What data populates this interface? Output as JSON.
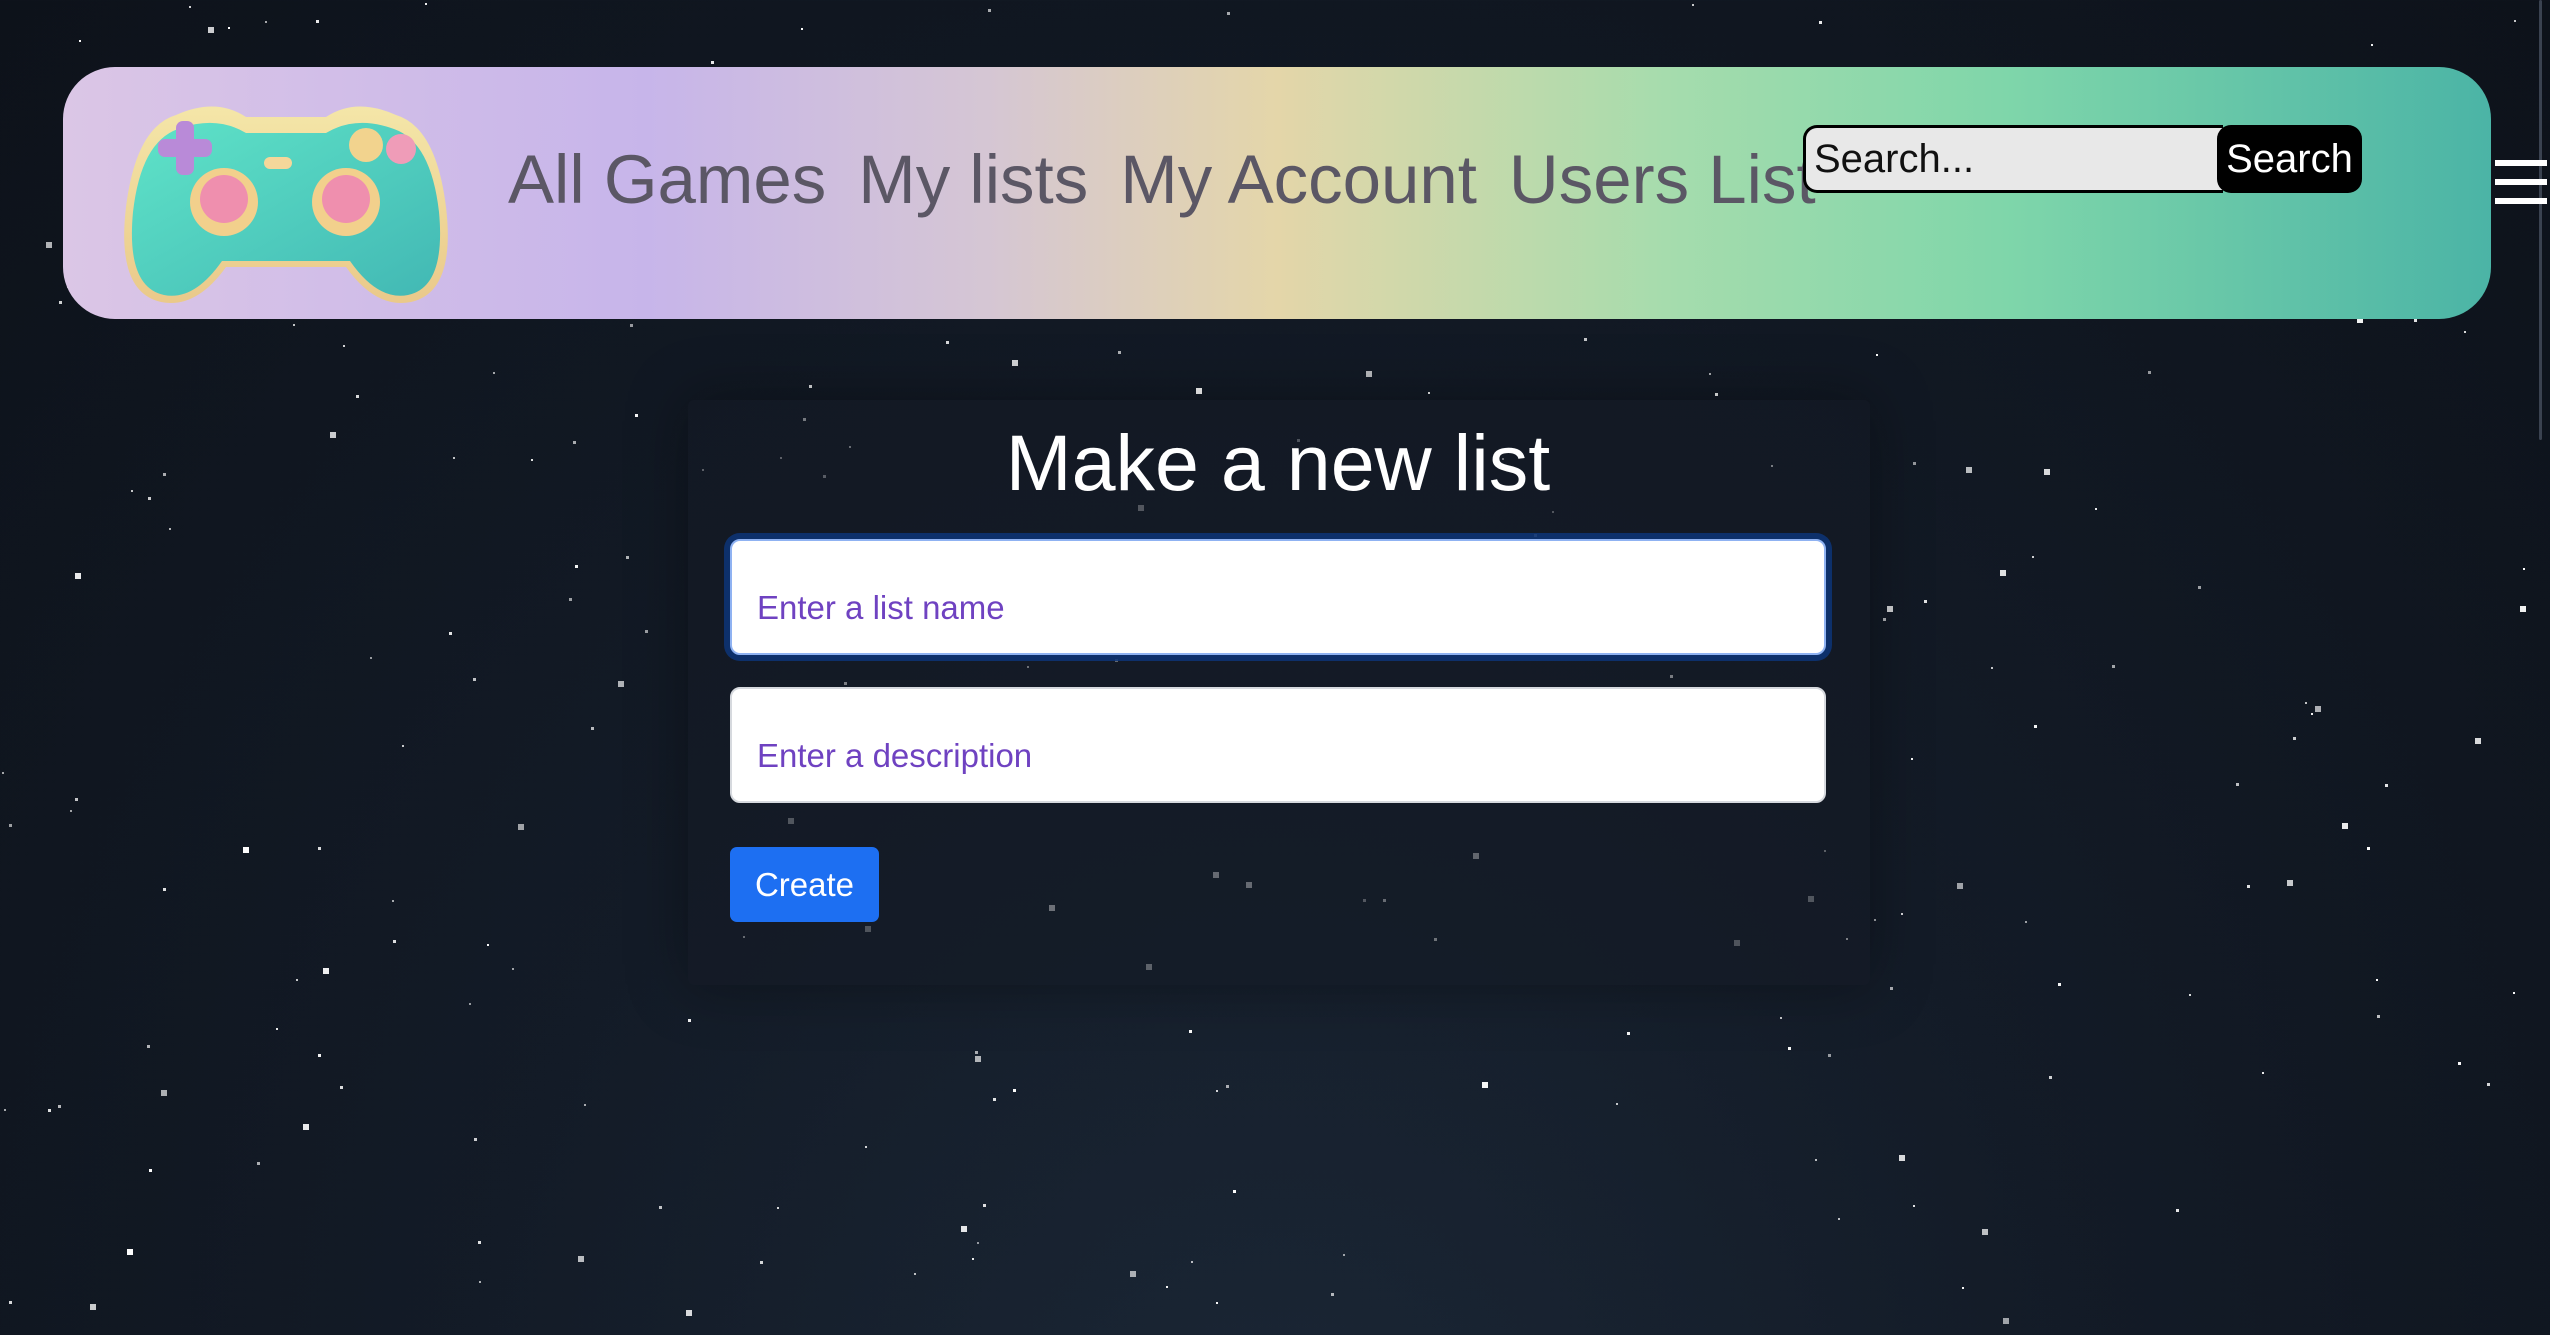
{
  "navbar": {
    "links": [
      {
        "label": "All Games"
      },
      {
        "label": "My lists"
      },
      {
        "label": "My Account"
      },
      {
        "label": "Users List"
      }
    ],
    "search": {
      "placeholder": "Search...",
      "button_label": "Search"
    }
  },
  "form": {
    "title": "Make a new list",
    "name_placeholder": "Enter a list name",
    "description_placeholder": "Enter a description",
    "create_label": "Create"
  },
  "icons": {
    "logo": "gamepad-icon",
    "menu": "hamburger-menu-icon"
  },
  "colors": {
    "primary_button": "#1d6ff2",
    "placeholder_text": "#6f42c1",
    "background": "#111823"
  }
}
